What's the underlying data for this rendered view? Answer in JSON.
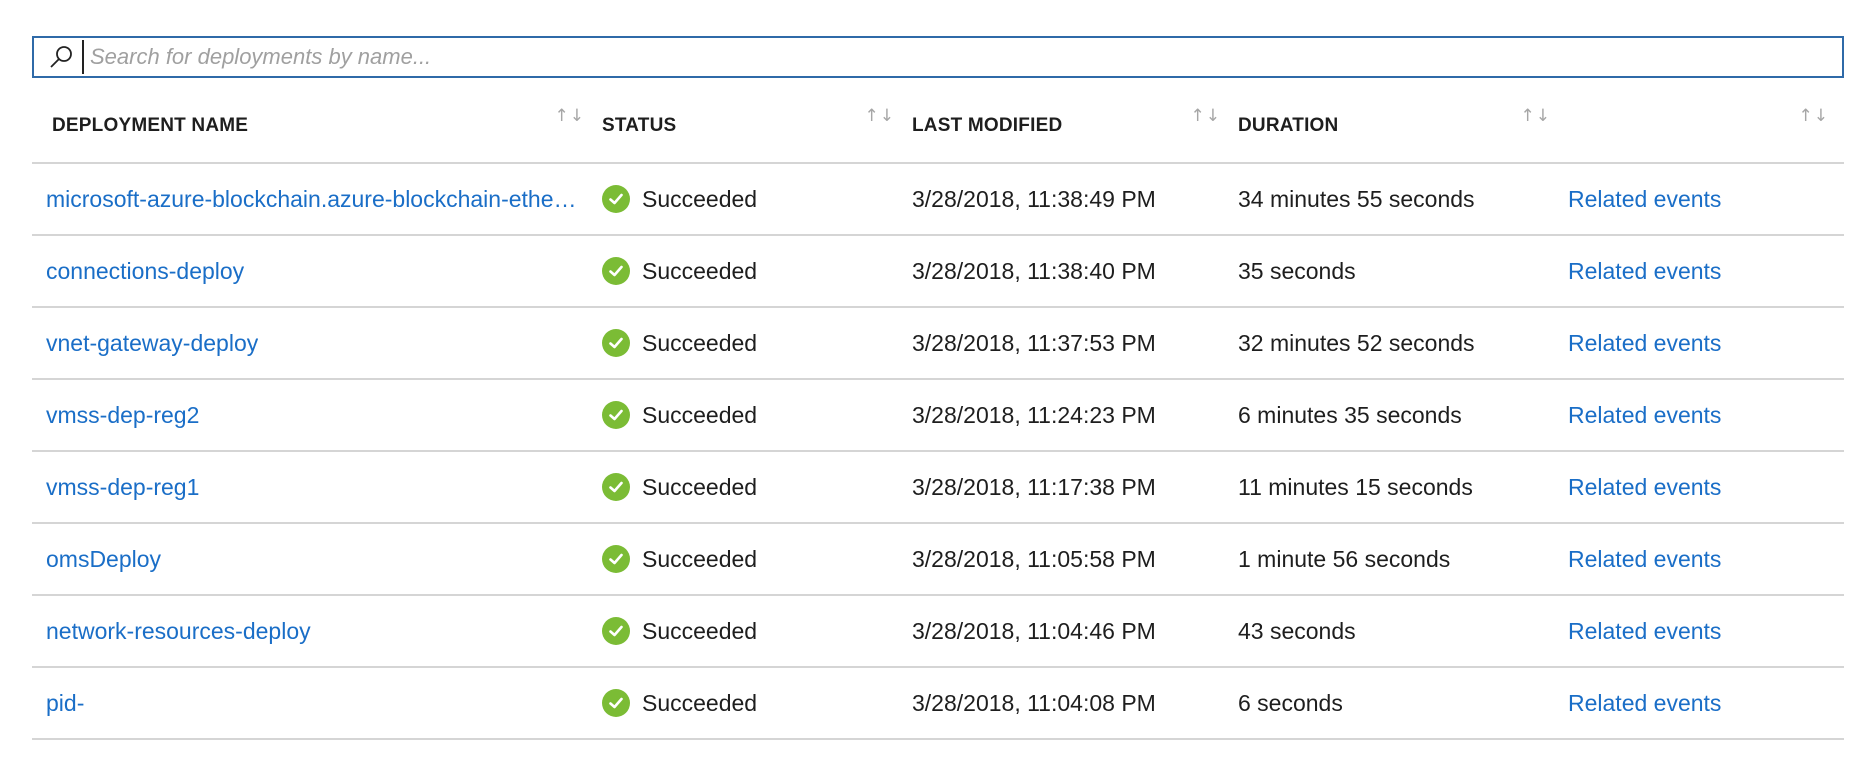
{
  "search": {
    "placeholder": "Search for deployments by name..."
  },
  "columns": [
    {
      "label": "DEPLOYMENT NAME"
    },
    {
      "label": "STATUS"
    },
    {
      "label": "LAST MODIFIED"
    },
    {
      "label": "DURATION"
    },
    {
      "label": ""
    }
  ],
  "icons": {
    "search": "search-icon",
    "sort": "sort-icon",
    "status_success": "check-circle-icon"
  },
  "colors": {
    "accent": "#1a6ec7",
    "search_border": "#2f6aa8",
    "success": "#7bbc35",
    "divider": "#d5d5d5"
  },
  "rows": [
    {
      "name": "microsoft-azure-blockchain.azure-blockchain-ethe…",
      "status": "Succeeded",
      "modified": "3/28/2018, 11:38:49 PM",
      "duration": "34 minutes 55 seconds",
      "events": "Related events"
    },
    {
      "name": "connections-deploy",
      "status": "Succeeded",
      "modified": "3/28/2018, 11:38:40 PM",
      "duration": "35 seconds",
      "events": "Related events"
    },
    {
      "name": "vnet-gateway-deploy",
      "status": "Succeeded",
      "modified": "3/28/2018, 11:37:53 PM",
      "duration": "32 minutes 52 seconds",
      "events": "Related events"
    },
    {
      "name": "vmss-dep-reg2",
      "status": "Succeeded",
      "modified": "3/28/2018, 11:24:23 PM",
      "duration": "6 minutes 35 seconds",
      "events": "Related events"
    },
    {
      "name": "vmss-dep-reg1",
      "status": "Succeeded",
      "modified": "3/28/2018, 11:17:38 PM",
      "duration": "11 minutes 15 seconds",
      "events": "Related events"
    },
    {
      "name": "omsDeploy",
      "status": "Succeeded",
      "modified": "3/28/2018, 11:05:58 PM",
      "duration": "1 minute 56 seconds",
      "events": "Related events"
    },
    {
      "name": "network-resources-deploy",
      "status": "Succeeded",
      "modified": "3/28/2018, 11:04:46 PM",
      "duration": "43 seconds",
      "events": "Related events"
    },
    {
      "name": "pid-",
      "status": "Succeeded",
      "modified": "3/28/2018, 11:04:08 PM",
      "duration": "6 seconds",
      "events": "Related events"
    }
  ]
}
